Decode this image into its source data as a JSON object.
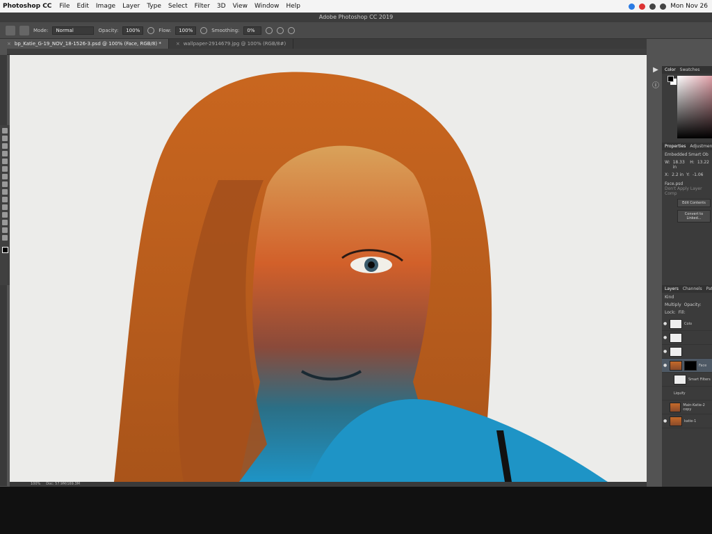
{
  "menubar": {
    "app": "Photoshop CC",
    "items": [
      "File",
      "Edit",
      "Image",
      "Layer",
      "Type",
      "Select",
      "Filter",
      "3D",
      "View",
      "Window",
      "Help"
    ],
    "clock": "Mon Nov 26"
  },
  "window": {
    "title": "Adobe Photoshop CC 2019"
  },
  "options": {
    "mode_label": "Mode:",
    "mode_value": "Normal",
    "opacity_label": "Opacity:",
    "opacity_value": "100%",
    "flow_label": "Flow:",
    "flow_value": "100%",
    "smoothing_label": "Smoothing:",
    "smoothing_value": "0%"
  },
  "tabs": [
    {
      "label": "bp_Katie_G-19_NOV_18-1526-3.psd @ 100% (Face, RGB/8) *"
    },
    {
      "label": "wallpaper-2914679.jpg @ 100% (RGB/8#)"
    }
  ],
  "status": {
    "zoom": "100%",
    "doc": "Doc: 57.9M/169.3M"
  },
  "panels": {
    "color_tabs": [
      "Color",
      "Swatches"
    ],
    "properties_tabs": [
      "Properties",
      "Adjustments"
    ],
    "smart_object": "Embedded Smart Ob",
    "w_label": "W:",
    "w_value": "18.33 in",
    "h_label": "H:",
    "h_value": "13.22",
    "x_label": "X:",
    "x_value": "2.2 in",
    "y_label": "Y:",
    "y_value": "-1.06",
    "face_path": "Face.psd",
    "layer_comp": "Don't Apply Layer Comp",
    "edit_btn": "Edit Contents",
    "convert_btn": "Convert to Linked...",
    "layers_tabs": [
      "Layers",
      "Channels",
      "Paths"
    ],
    "kind": "Kind",
    "blend": "Multiply",
    "opacity_short": "Opacity:",
    "lock": "Lock:",
    "fill": "Fill:",
    "layers": [
      {
        "name": "Colo"
      },
      {
        "name": ""
      },
      {
        "name": ""
      },
      {
        "name": "Face"
      },
      {
        "name": "Smart Filters"
      },
      {
        "name": "Liquify"
      },
      {
        "name": "Main-Katie-2 copy"
      },
      {
        "name": "katie-1"
      }
    ]
  }
}
